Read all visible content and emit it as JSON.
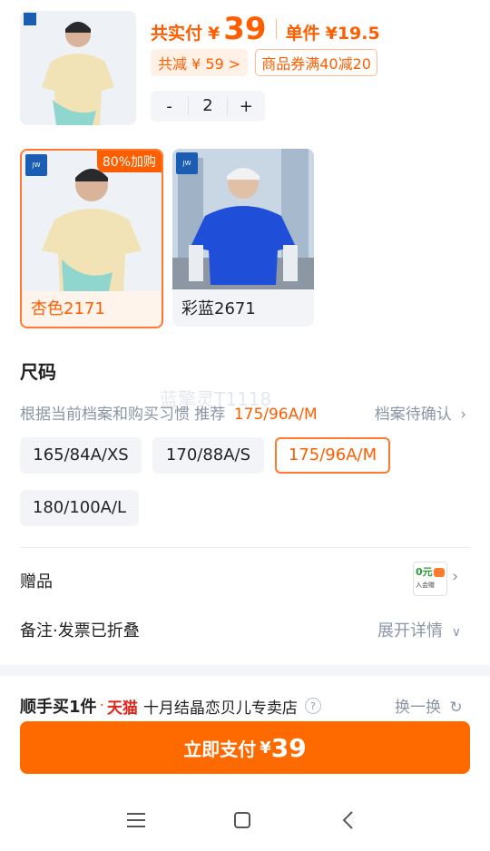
{
  "header": {
    "total_label": "共实付",
    "currency": "¥",
    "total_price": "39",
    "unit_label": "单件",
    "unit_price": "¥19.5",
    "discount": "共减 ¥ 59 >",
    "coupon": "商品券满40减20",
    "quantity": "2",
    "minus": "-",
    "plus": "+"
  },
  "colors": [
    {
      "name": "杏色2171",
      "badge": "80%加购",
      "selected": true,
      "shirt_color": "#f1e3b5"
    },
    {
      "name": "彩蓝2671",
      "selected": false,
      "shirt_color": "#1f4fd8"
    }
  ],
  "size": {
    "title": "尺码",
    "rec_prefix": "根据当前档案和购买习惯 推荐",
    "rec_value": "175/96A/M",
    "profile_link": "档案待确认",
    "watermark": "蓝擎灵T1118",
    "options": [
      {
        "label": "165/84A/XS",
        "selected": false
      },
      {
        "label": "170/88A/S",
        "selected": false
      },
      {
        "label": "175/96A/M",
        "selected": true
      },
      {
        "label": "180/100A/L",
        "selected": false
      }
    ]
  },
  "gift": {
    "label": "赠品",
    "badge_big": "0元",
    "badge_small": "入会赠"
  },
  "note": {
    "label": "备注·发票已折叠",
    "expand": "展开详情"
  },
  "bottom": {
    "left_text": "顺手买1件",
    "dot": "·",
    "platform": "天猫",
    "store": "十月结晶恋贝儿专卖店",
    "help": "?",
    "switch": "换一换",
    "pay_label": "立即支付",
    "pay_currency": "¥",
    "pay_amount": "39"
  },
  "accent": "#ff5e00"
}
